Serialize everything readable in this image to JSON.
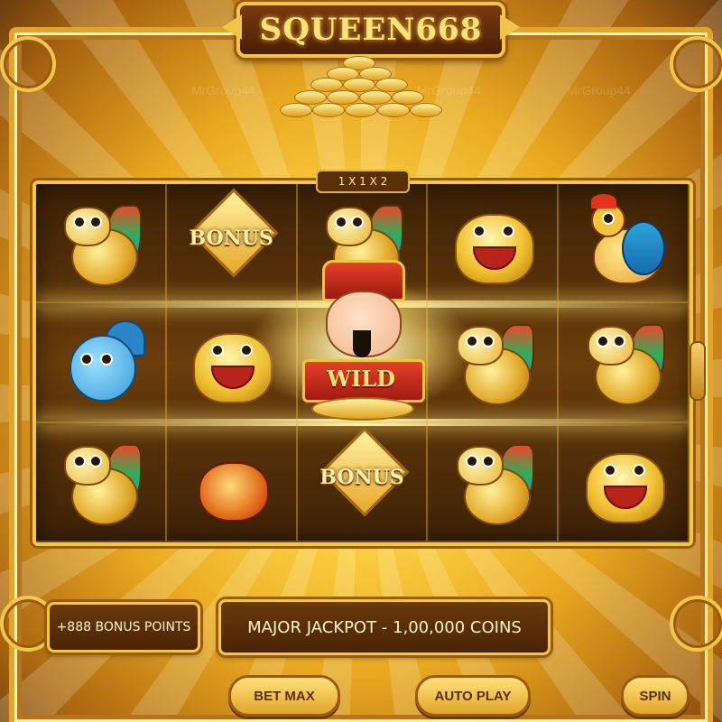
{
  "header": {
    "title": "SQUEEN668"
  },
  "multiplier_label": "1 X 1 X 2",
  "reels": [
    [
      "dragon-gold",
      "bonus",
      "dragon-gold",
      "toad-gold",
      "bird-red"
    ],
    [
      "dragon-blue",
      "toad-gold",
      "wild",
      "dragon-gold",
      "dragon-gold"
    ],
    [
      "dragon-gold",
      "dragon-red",
      "bonus",
      "dragon-gold",
      "toad-gold"
    ]
  ],
  "symbols": {
    "bonus_label": "BONUS",
    "wild_label": "WILD"
  },
  "info": {
    "bonus_points": "+888 BONUS POINTS",
    "jackpot": "MAJOR JACKPOT - 1,00,000 COINS"
  },
  "controls": {
    "bet_max": "BET MAX",
    "auto_play": "AUTO PLAY",
    "spin": "SPIN"
  },
  "watermark": "MrGroup44",
  "colors": {
    "gold": "#f3c64a",
    "brown": "#4a2406",
    "red": "#e4321e"
  }
}
